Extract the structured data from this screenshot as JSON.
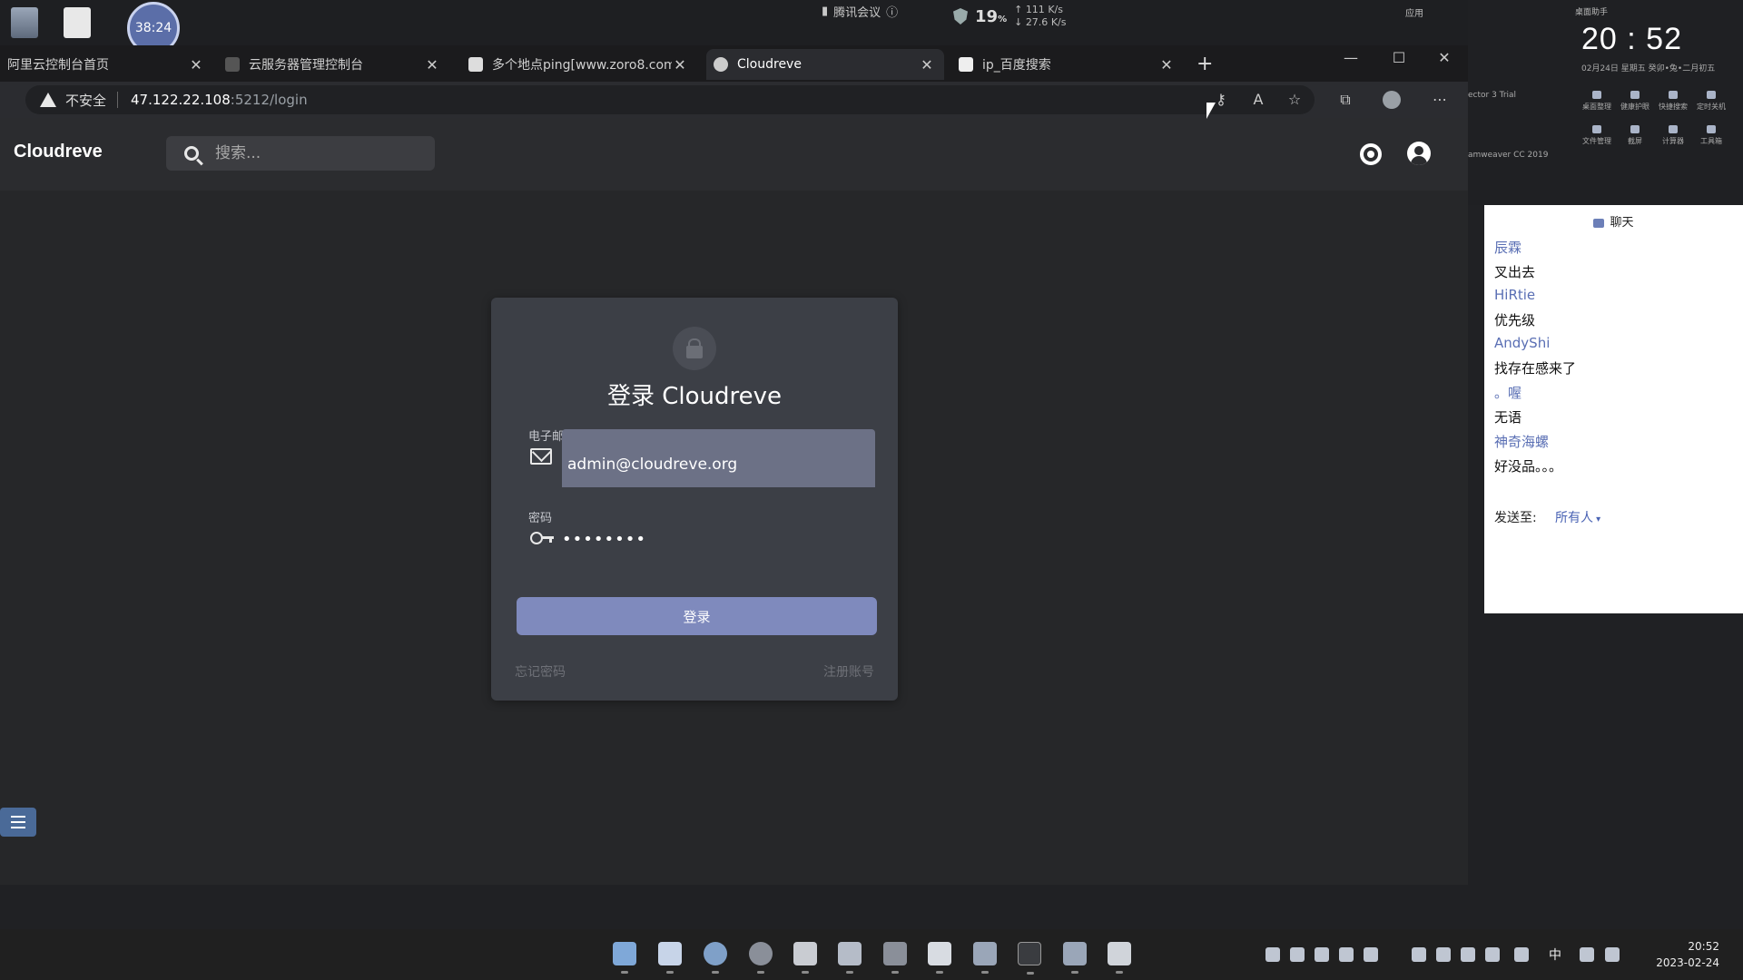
{
  "desktop": {
    "timer": "38:24",
    "meeting_app": "腾讯会议",
    "net_percent": "19",
    "net_percent_unit": "%",
    "net_up": "111",
    "net_down": "27.6",
    "net_unit": "K/s"
  },
  "tabs": [
    {
      "title": "阿里云控制台首页"
    },
    {
      "title": "云服务器管理控制台"
    },
    {
      "title": "多个地点ping[www.zoro8.com]"
    },
    {
      "title": "Cloudreve"
    },
    {
      "title": "ip_百度搜索"
    }
  ],
  "address_bar": {
    "security_label": "不安全",
    "url_host": "47.122.22.108",
    "url_path": ":5212/login"
  },
  "app": {
    "title": "Cloudreve",
    "search_placeholder": "搜索..."
  },
  "login": {
    "title": "登录 Cloudreve",
    "email_label": "电子邮箱",
    "email_value": "admin@cloudreve.org",
    "password_label": "密码",
    "password_value": "••••••••",
    "submit_label": "登录",
    "forgot_label": "忘记密码",
    "register_label": "注册账号"
  },
  "right_panel": {
    "apps_label": "应用",
    "assistant_label": "桌面助手",
    "clock": "20 : 52",
    "clock_date": "02月24日   星期五   癸卯•兔•二月初五",
    "sidebar_fragment_1": "ector 3 Trial",
    "sidebar_fragment_2": "amweaver CC 2019",
    "tools": [
      "桌面整理",
      "健康护眼",
      "快捷搜索",
      "定时关机",
      "文件管理",
      "截屏",
      "计算器",
      "工具箱"
    ]
  },
  "chat": {
    "header": "聊天",
    "messages": [
      {
        "name": "辰霖",
        "text": "叉出去"
      },
      {
        "name": "HiRtie",
        "text": "优先级"
      },
      {
        "name": "AndyShi",
        "text": "找存在感来了"
      },
      {
        "name": "。喔",
        "text": "无语"
      },
      {
        "name": "神奇海螺",
        "text": "好没品。。。"
      }
    ],
    "send_to_label": "发送至:",
    "send_to_value": "所有人"
  },
  "taskbar": {
    "time": "20:52",
    "date": "2023-02-24",
    "ime": "中"
  },
  "colors": {
    "accent": "#7f8abd",
    "email_fill": "#6c7186",
    "card": "#3c3f46",
    "page_bg": "#262729",
    "link_blue": "#5a6fb4"
  }
}
